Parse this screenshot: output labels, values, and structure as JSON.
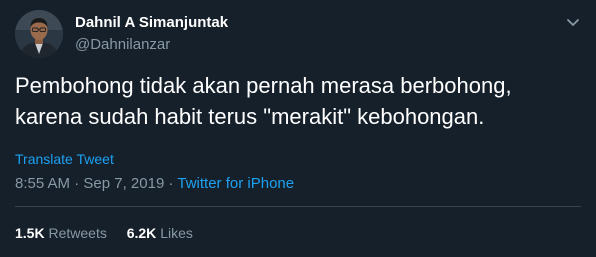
{
  "author": {
    "display_name": "Dahnil A Simanjuntak",
    "handle": "@Dahnilanzar",
    "avatar_icon": "profile-photo"
  },
  "menu_icon": "chevron-down-icon",
  "tweet": {
    "lines": [
      "Pembohong tidak akan pernah merasa berbohong,",
      "karena sudah habit terus \"merakit\" kebohongan."
    ],
    "translate_label": "Translate Tweet",
    "time": "8:55 AM",
    "separator": "·",
    "date": "Sep 7, 2019",
    "source": "Twitter for iPhone"
  },
  "stats": {
    "retweets_count": "1.5K",
    "retweets_label": "Retweets",
    "likes_count": "6.2K",
    "likes_label": "Likes"
  },
  "colors": {
    "background": "#15202b",
    "primary_text": "#ffffff",
    "secondary_text": "#8899a6",
    "link": "#1da1f2",
    "divider": "#38444d"
  }
}
